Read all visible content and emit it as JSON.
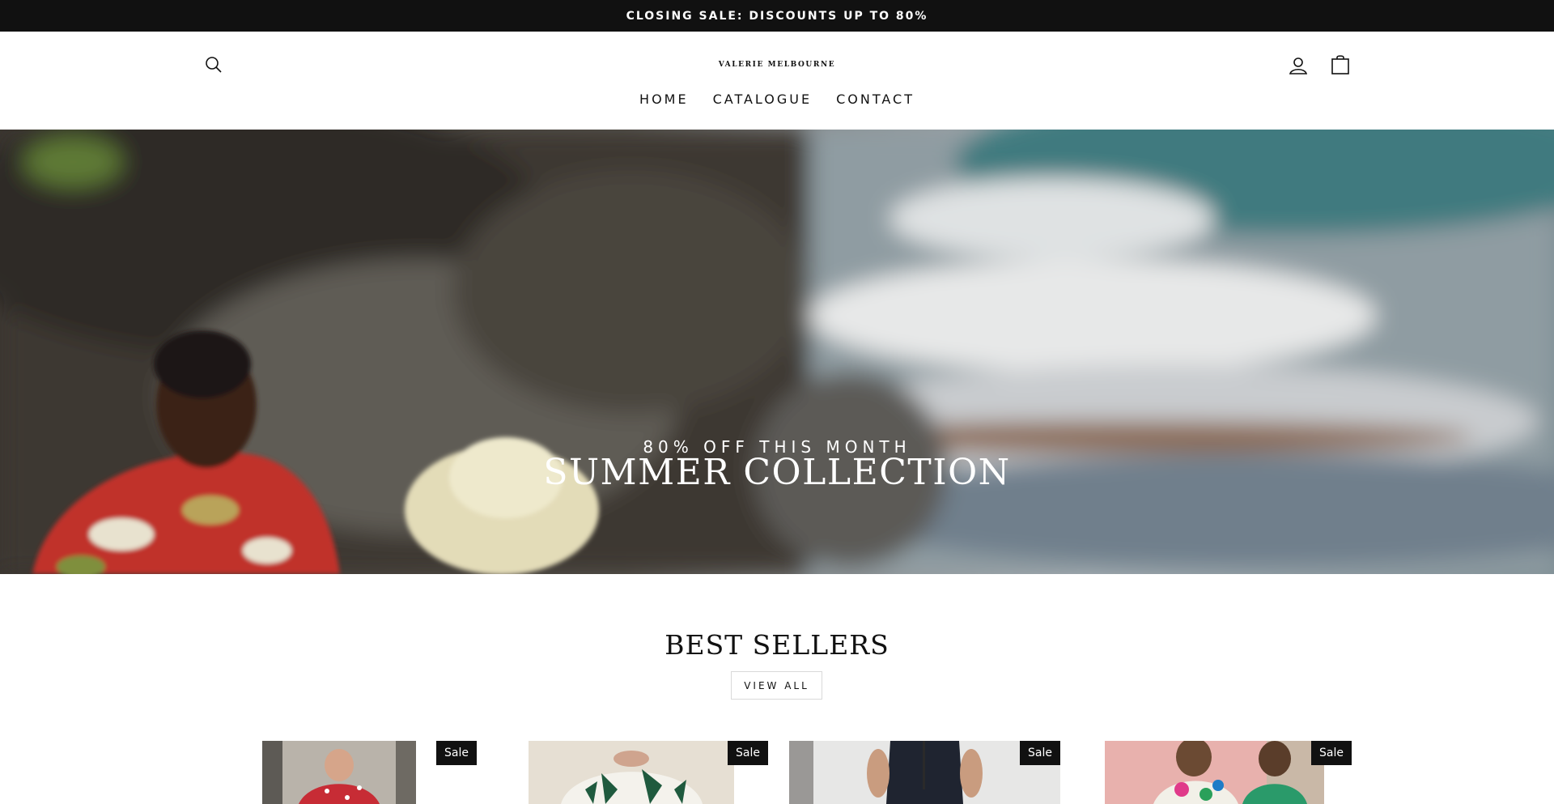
{
  "announcement": {
    "text": "CLOSING SALE: DISCOUNTS UP TO 80%"
  },
  "header": {
    "logo": "VALERIE MELBOURNE",
    "nav": [
      {
        "label": "HOME"
      },
      {
        "label": "CATALOGUE"
      },
      {
        "label": "CONTACT"
      }
    ],
    "icons": {
      "search": "search-icon",
      "account": "user-icon",
      "cart": "shopping-bag-icon"
    }
  },
  "hero": {
    "subtitle": "80% OFF THIS MONTH",
    "title": "SUMMER COLLECTION"
  },
  "best_sellers": {
    "title": "BEST SELLERS",
    "view_all": "VIEW ALL",
    "products": [
      {
        "badge": "Sale"
      },
      {
        "badge": "Sale"
      },
      {
        "badge": "Sale"
      },
      {
        "badge": "Sale"
      }
    ]
  },
  "colors": {
    "announcement_bg": "#111111",
    "badge_bg": "#111111",
    "text": "#111111"
  }
}
